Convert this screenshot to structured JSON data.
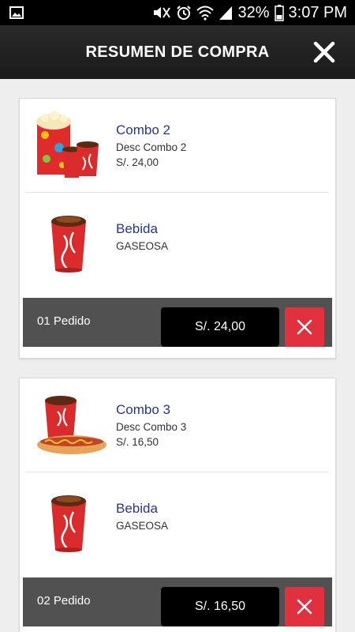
{
  "status_bar": {
    "battery": "32%",
    "time": "3:07 PM",
    "icons": [
      "image-icon",
      "mute-icon",
      "alarm-icon",
      "wifi-icon",
      "signal-icon",
      "battery-icon"
    ]
  },
  "header": {
    "title": "RESUMEN DE COMPRA",
    "close_icon": "close-icon"
  },
  "orders": [
    {
      "label": "01 Pedido",
      "total": "S/. 24,00",
      "items": [
        {
          "name": "Combo 2",
          "desc": "Desc Combo 2",
          "price": "S/. 24,00",
          "image": "popcorn-and-drinks"
        },
        {
          "name": "Bebida",
          "desc": "GASEOSA",
          "image": "soda-cup"
        }
      ]
    },
    {
      "label": "02 Pedido",
      "total": "S/. 16,50",
      "items": [
        {
          "name": "Combo 3",
          "desc": "Desc Combo 3",
          "price": "S/. 16,50",
          "image": "hotdog-and-drink"
        },
        {
          "name": "Bebida",
          "desc": "GASEOSA",
          "image": "soda-cup"
        }
      ]
    }
  ],
  "colors": {
    "accent_blue": "#27368d",
    "delete_red": "#e1313f",
    "footer_gray": "#515151",
    "header_dark": "#222222"
  }
}
